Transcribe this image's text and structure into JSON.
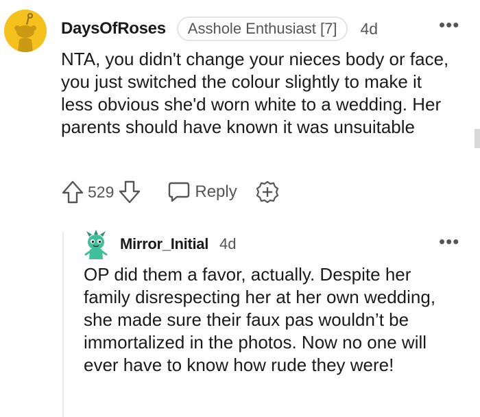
{
  "comment": {
    "username": "DaysOfRoses",
    "flair": "Asshole Enthusiast [7]",
    "age": "4d",
    "more": "•••",
    "body": "NTA, you didn't change your nieces body or face, you just switched the colour slightly to make it less obvious she'd worn white to a wedding. Her parents should have known it was unsuitable",
    "score": "529",
    "reply_label": "Reply",
    "icons": [
      "snoo-avatar",
      "upvote-icon",
      "downvote-icon",
      "reply-icon",
      "award-icon",
      "more-icon"
    ],
    "colors": {
      "avatar_bg": "#f5c11d",
      "muted": "#555555"
    }
  },
  "reply": {
    "username": "Mirror_Initial",
    "age": "4d",
    "more": "•••",
    "body": "OP did them a favor, actually. Despite her family disrespecting her at her own wedding, she made sure their faux pas wouldn’t be immortalized in the photos. Now no one will ever have to know how rude they were!",
    "icons": [
      "dragon-avatar",
      "more-icon"
    ],
    "colors": {
      "avatar": "#3fbf9a"
    }
  }
}
